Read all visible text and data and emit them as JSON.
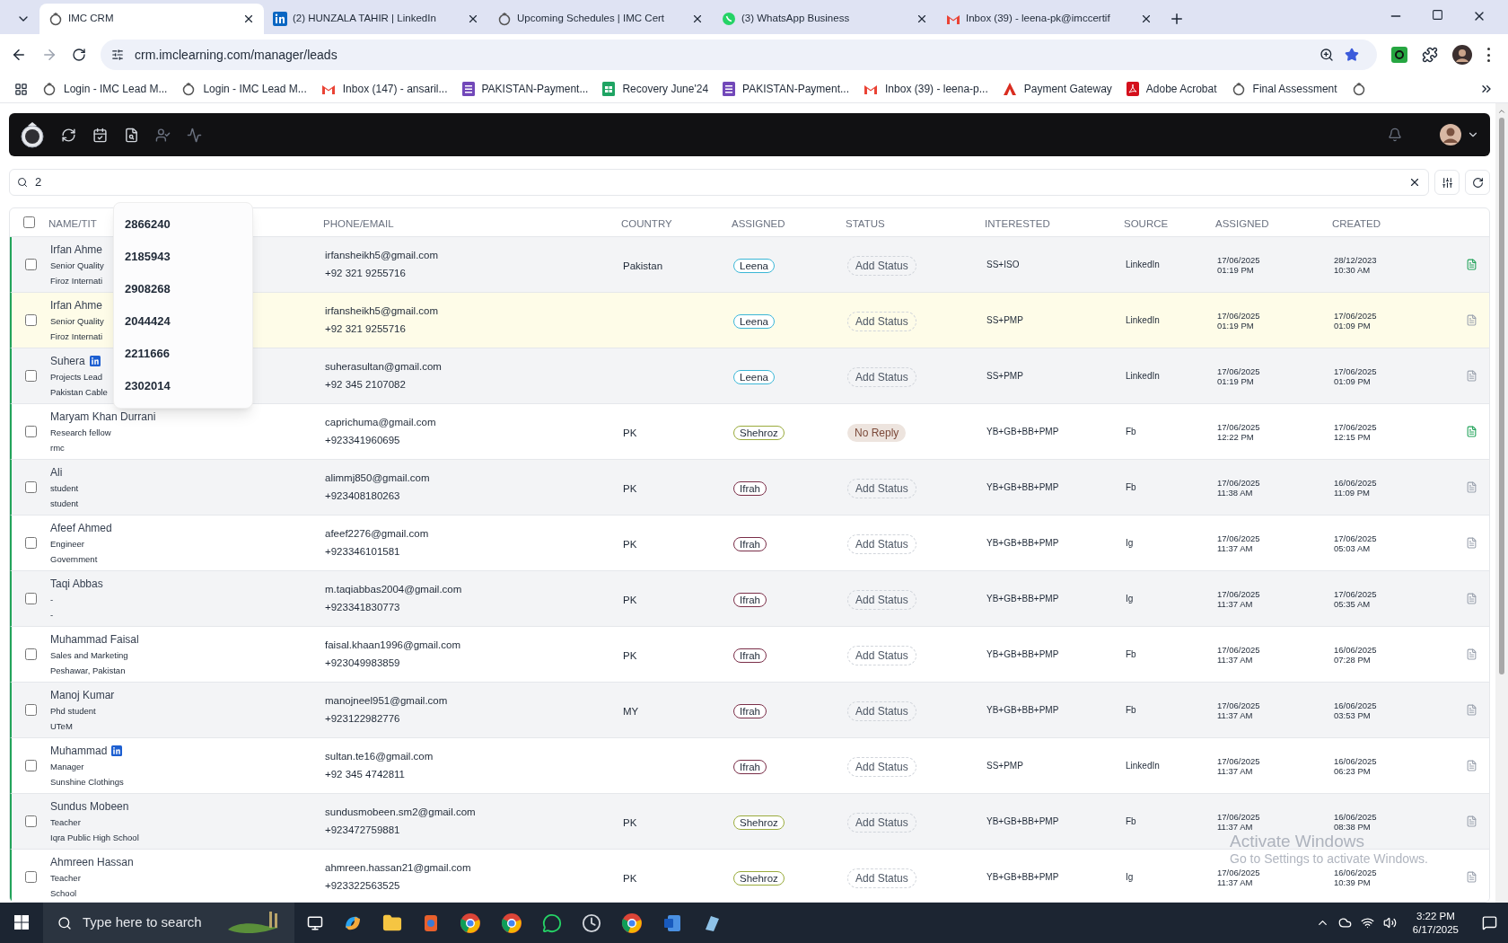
{
  "browser": {
    "tabs": [
      {
        "title": "IMC CRM",
        "selected": true
      },
      {
        "title": "(2) HUNZALA TAHIR | LinkedIn",
        "selected": false
      },
      {
        "title": "Upcoming Schedules | IMC Cert",
        "selected": false
      },
      {
        "title": "(3) WhatsApp Business",
        "selected": false
      },
      {
        "title": "Inbox (39) - leena-pk@imccertif",
        "selected": false
      }
    ],
    "url": "crm.imclearning.com/manager/leads",
    "bookmarks": [
      "Login - IMC Lead M...",
      "Login - IMC Lead M...",
      "Inbox (147) - ansaril...",
      "PAKISTAN-Payment...",
      "Recovery June'24",
      "PAKISTAN-Payment...",
      "Inbox (39) - leena-p...",
      "Payment Gateway",
      "Adobe Acrobat",
      "Final Assessment"
    ]
  },
  "search": {
    "value": "2",
    "suggestions": [
      "2866240",
      "2185943",
      "2908268",
      "2044424",
      "2211666",
      "2302014"
    ]
  },
  "table": {
    "all_checked": false,
    "columns": [
      "NAME/TIT",
      "PHONE/EMAIL",
      "COUNTRY",
      "ASSIGNED",
      "STATUS",
      "INTERESTED",
      "SOURCE",
      "ASSIGNED",
      "CREATED"
    ],
    "rows": [
      {
        "checked": false,
        "name": "Irfan Ahme",
        "title": "Senior Quality",
        "org": "Firoz Internati",
        "linkedin": false,
        "email": "irfansheikh5@gmail.com",
        "phone": "+92 321 9255716",
        "country": "Pakistan",
        "assigned": {
          "name": "Leena",
          "color": "#3bb6d6"
        },
        "status": {
          "kind": "empty",
          "label": "Add Status"
        },
        "interested": "SS+ISO",
        "source": "LinkedIn",
        "assigned_date": "17/06/2025",
        "assigned_time": "01:19 PM",
        "created_date": "28/12/2023",
        "created_time": "10:30 AM",
        "has_notes": true,
        "highlighted": false
      },
      {
        "checked": false,
        "name": "Irfan Ahme",
        "title": "Senior Quality",
        "org": "Firoz Internati",
        "linkedin": false,
        "email": "irfansheikh5@gmail.com",
        "phone": "+92 321 9255716",
        "assigned": {
          "name": "Leena",
          "color": "#3bb6d6"
        },
        "status": {
          "kind": "empty",
          "label": "Add Status"
        },
        "interested": "SS+PMP",
        "source": "LinkedIn",
        "assigned_date": "17/06/2025",
        "assigned_time": "01:19 PM",
        "created_date": "17/06/2025",
        "created_time": "01:09 PM",
        "has_notes": false,
        "highlighted": true
      },
      {
        "checked": false,
        "name": "Suhera",
        "title": "Projects Lead",
        "org": "Pakistan Cable",
        "linkedin": true,
        "email": "suherasultan@gmail.com",
        "phone": "+92 345 2107082",
        "assigned": {
          "name": "Leena",
          "color": "#3bb6d6"
        },
        "status": {
          "kind": "empty",
          "label": "Add Status"
        },
        "interested": "SS+PMP",
        "source": "LinkedIn",
        "assigned_date": "17/06/2025",
        "assigned_time": "01:19 PM",
        "created_date": "17/06/2025",
        "created_time": "01:09 PM",
        "has_notes": false,
        "highlighted": false
      },
      {
        "checked": false,
        "name": "Maryam Khan Durrani",
        "title": "Research fellow",
        "org": "rmc",
        "linkedin": false,
        "email": "caprichuma@gmail.com",
        "phone": "+923341960695",
        "country": "PK",
        "assigned": {
          "name": "Shehroz",
          "color": "#9aab3c"
        },
        "status": {
          "kind": "set",
          "label": "No Reply"
        },
        "interested": "YB+GB+BB+PMP",
        "source": "Fb",
        "assigned_date": "17/06/2025",
        "assigned_time": "12:22 PM",
        "created_date": "17/06/2025",
        "created_time": "12:15 PM",
        "has_notes": true,
        "highlighted": false
      },
      {
        "checked": false,
        "name": "Ali",
        "title": "student",
        "org": "student",
        "linkedin": false,
        "email": "alimmj850@gmail.com",
        "phone": "+923408180263",
        "country": "PK",
        "assigned": {
          "name": "Ifrah",
          "color": "#7a2e48"
        },
        "status": {
          "kind": "empty",
          "label": "Add Status"
        },
        "interested": "YB+GB+BB+PMP",
        "source": "Fb",
        "assigned_date": "17/06/2025",
        "assigned_time": "11:38 AM",
        "created_date": "16/06/2025",
        "created_time": "11:09 PM",
        "has_notes": false,
        "highlighted": false
      },
      {
        "checked": false,
        "name": "Afeef Ahmed",
        "title": "Engineer",
        "org": "Government",
        "linkedin": false,
        "email": "afeef2276@gmail.com",
        "phone": "+923346101581",
        "country": "PK",
        "assigned": {
          "name": "Ifrah",
          "color": "#7a2e48"
        },
        "status": {
          "kind": "empty",
          "label": "Add Status"
        },
        "interested": "YB+GB+BB+PMP",
        "source": "Ig",
        "assigned_date": "17/06/2025",
        "assigned_time": "11:37 AM",
        "created_date": "17/06/2025",
        "created_time": "05:03 AM",
        "has_notes": false,
        "highlighted": false
      },
      {
        "checked": false,
        "name": "Taqi Abbas",
        "title": "-",
        "org": "-",
        "linkedin": false,
        "email": "m.taqiabbas2004@gmail.com",
        "phone": "+923341830773",
        "country": "PK",
        "assigned": {
          "name": "Ifrah",
          "color": "#7a2e48"
        },
        "status": {
          "kind": "empty",
          "label": "Add Status"
        },
        "interested": "YB+GB+BB+PMP",
        "source": "Ig",
        "assigned_date": "17/06/2025",
        "assigned_time": "11:37 AM",
        "created_date": "17/06/2025",
        "created_time": "05:35 AM",
        "has_notes": false,
        "highlighted": false
      },
      {
        "checked": false,
        "name": "Muhammad Faisal",
        "title": "Sales and Marketing",
        "org": "Peshawar, Pakistan",
        "linkedin": false,
        "email": "faisal.khaan1996@gmail.com",
        "phone": "+923049983859",
        "country": "PK",
        "assigned": {
          "name": "Ifrah",
          "color": "#7a2e48"
        },
        "status": {
          "kind": "empty",
          "label": "Add Status"
        },
        "interested": "YB+GB+BB+PMP",
        "source": "Fb",
        "assigned_date": "17/06/2025",
        "assigned_time": "11:37 AM",
        "created_date": "16/06/2025",
        "created_time": "07:28 PM",
        "has_notes": false,
        "highlighted": false
      },
      {
        "checked": false,
        "name": "Manoj Kumar",
        "title": "Phd student",
        "org": "UTeM",
        "linkedin": false,
        "email": "manojneel951@gmail.com",
        "phone": "+923122982776",
        "country": "MY",
        "assigned": {
          "name": "Ifrah",
          "color": "#7a2e48"
        },
        "status": {
          "kind": "empty",
          "label": "Add Status"
        },
        "interested": "YB+GB+BB+PMP",
        "source": "Fb",
        "assigned_date": "17/06/2025",
        "assigned_time": "11:37 AM",
        "created_date": "16/06/2025",
        "created_time": "03:53 PM",
        "has_notes": false,
        "highlighted": false
      },
      {
        "checked": false,
        "name": "Muhammad",
        "title": "Manager",
        "org": "Sunshine Clothings",
        "linkedin": true,
        "email": "sultan.te16@gmail.com",
        "phone": "+92 345 4742811",
        "assigned": {
          "name": "Ifrah",
          "color": "#7a2e48"
        },
        "status": {
          "kind": "empty",
          "label": "Add Status"
        },
        "interested": "SS+PMP",
        "source": "LinkedIn",
        "assigned_date": "17/06/2025",
        "assigned_time": "11:37 AM",
        "created_date": "16/06/2025",
        "created_time": "06:23 PM",
        "has_notes": false,
        "highlighted": false
      },
      {
        "checked": false,
        "name": "Sundus Mobeen",
        "title": "Teacher",
        "org": "Iqra Public High School",
        "linkedin": false,
        "email": "sundusmobeen.sm2@gmail.com",
        "phone": "+923472759881",
        "country": "PK",
        "assigned": {
          "name": "Shehroz",
          "color": "#9aab3c"
        },
        "status": {
          "kind": "empty",
          "label": "Add Status"
        },
        "interested": "YB+GB+BB+PMP",
        "source": "Fb",
        "assigned_date": "17/06/2025",
        "assigned_time": "11:37 AM",
        "created_date": "16/06/2025",
        "created_time": "08:38 PM",
        "has_notes": false,
        "highlighted": false
      },
      {
        "checked": false,
        "name": "Ahmreen Hassan",
        "title": "Teacher",
        "org": "School",
        "linkedin": false,
        "email": "ahmreen.hassan21@gmail.com",
        "phone": "+923322563525",
        "country": "PK",
        "assigned": {
          "name": "Shehroz",
          "color": "#9aab3c"
        },
        "status": {
          "kind": "empty",
          "label": "Add Status"
        },
        "interested": "YB+GB+BB+PMP",
        "source": "Ig",
        "assigned_date": "17/06/2025",
        "assigned_time": "11:37 AM",
        "created_date": "16/06/2025",
        "created_time": "10:39 PM",
        "has_notes": false,
        "highlighted": false
      }
    ]
  },
  "os_notice": {
    "title": "Activate Windows",
    "text": "Go to Settings to activate Windows."
  },
  "taskbar": {
    "search_placeholder": "Type here to search",
    "time": "3:22 PM",
    "date": "6/17/2025"
  }
}
